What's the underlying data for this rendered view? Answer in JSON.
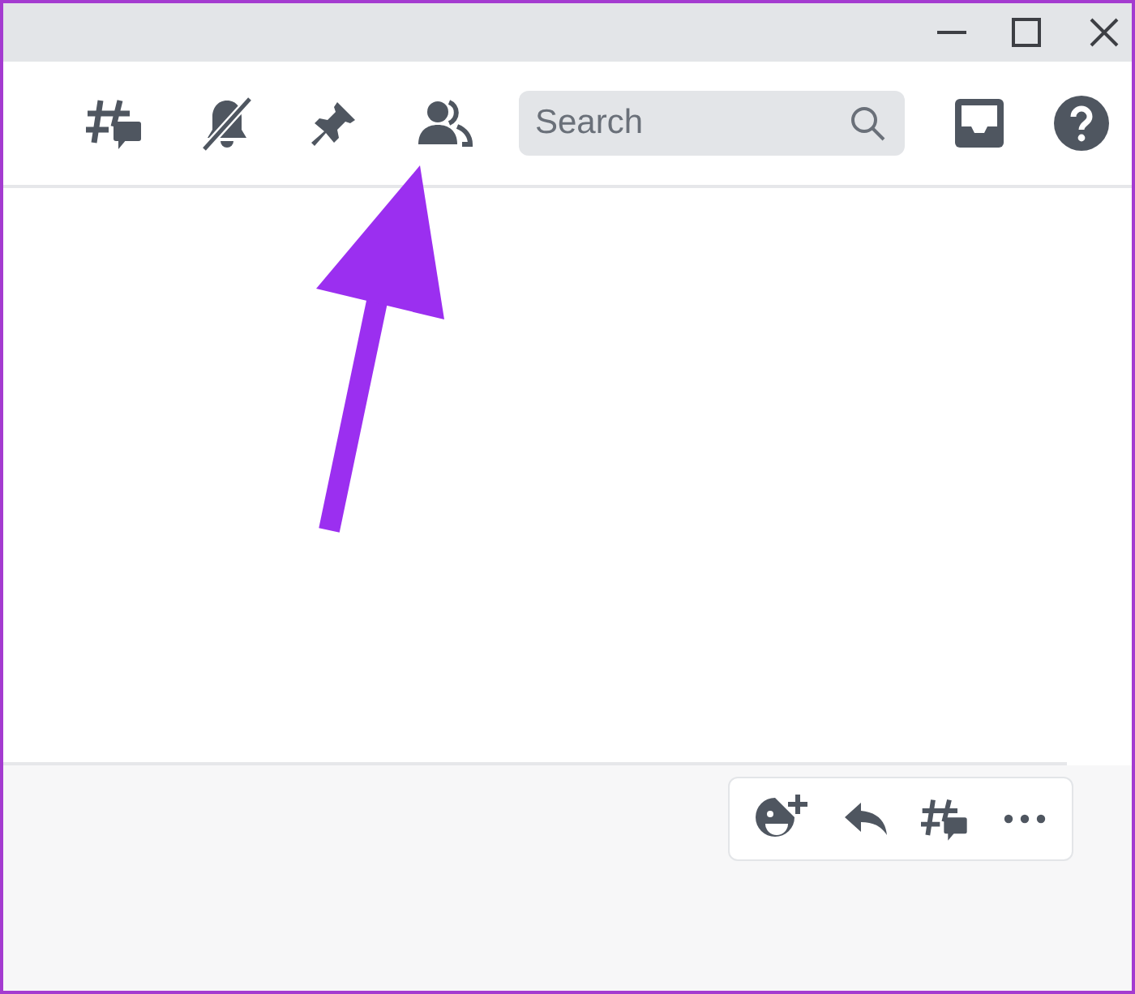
{
  "header": {
    "search": {
      "placeholder": "Search"
    }
  }
}
